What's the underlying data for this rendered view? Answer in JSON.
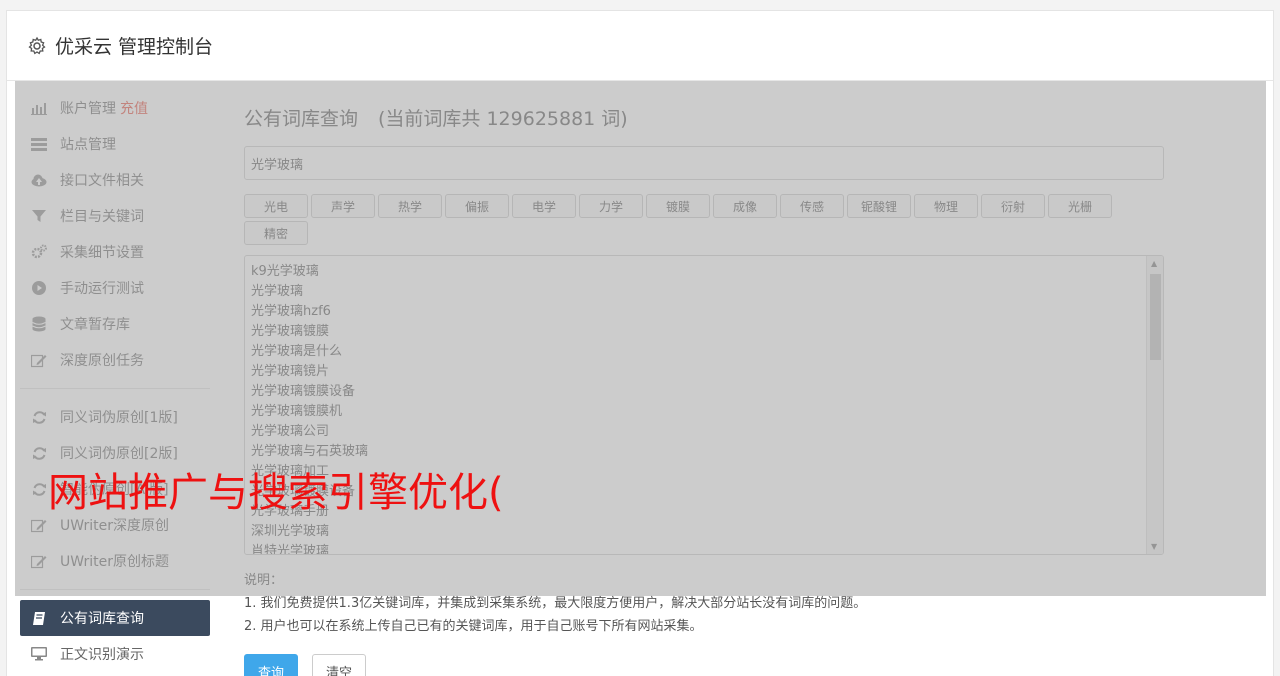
{
  "header": {
    "title": "优采云 管理控制台",
    "icon": "gear-icon"
  },
  "sidebar": {
    "items": [
      {
        "label": "账户管理",
        "badge": "充值",
        "icon": "bar-chart-icon"
      },
      {
        "label": "站点管理",
        "icon": "server-icon"
      },
      {
        "label": "接口文件相关",
        "icon": "cloud-upload-icon"
      },
      {
        "label": "栏目与关键词",
        "icon": "filter-icon"
      },
      {
        "label": "采集细节设置",
        "icon": "gears-icon"
      },
      {
        "label": "手动运行测试",
        "icon": "play-circle-icon"
      },
      {
        "label": "文章暂存库",
        "icon": "database-icon"
      },
      {
        "label": "深度原创任务",
        "icon": "edit-icon"
      }
    ],
    "items2": [
      {
        "label": "同义词伪原创[1版]",
        "icon": "refresh-icon"
      },
      {
        "label": "同义词伪原创[2版]",
        "icon": "refresh-icon"
      },
      {
        "label": "智能伪原创[AI版]",
        "icon": "refresh-icon"
      },
      {
        "label": "UWriter深度原创",
        "icon": "edit-icon"
      },
      {
        "label": "UWriter原创标题",
        "icon": "edit-icon"
      }
    ],
    "items3": [
      {
        "label": "公有词库查询",
        "icon": "book-icon",
        "active": true
      },
      {
        "label": "正文识别演示",
        "icon": "monitor-icon"
      }
    ]
  },
  "main": {
    "title": "公有词库查询",
    "count_text": "(当前词库共 129625881 词)",
    "search_value": "光学玻璃",
    "tags": [
      "光电",
      "声学",
      "热学",
      "偏振",
      "电学",
      "力学",
      "镀膜",
      "成像",
      "传感",
      "铌酸锂",
      "物理",
      "衍射",
      "光栅",
      "精密"
    ],
    "results": [
      "k9光学玻璃",
      "光学玻璃",
      "光学玻璃hzf6",
      "光学玻璃镀膜",
      "光学玻璃是什么",
      "光学玻璃镜片",
      "光学玻璃镀膜设备",
      "光学玻璃镀膜机",
      "光学玻璃公司",
      "光学玻璃与石英玻璃",
      "光学玻璃加工",
      "光学玻璃镀膜设备",
      "光学玻璃手册",
      "深圳光学玻璃",
      "肖特光学玻璃"
    ],
    "notes_title": "说明：",
    "notes": [
      "1. 我们免费提供1.3亿关键词库，并集成到采集系统，最大限度方便用户，解决大部分站长没有词库的问题。",
      "2. 用户也可以在系统上传自己已有的关键词库，用于自己账号下所有网站采集。"
    ],
    "query_button": "查询",
    "clear_button": "清空"
  },
  "watermark": "网站推广与搜索引擎优化(",
  "colors": {
    "accent": "#3fa7ea",
    "active_nav": "#3b4a5e",
    "badge": "#e74c3c",
    "watermark": "#ee1111"
  }
}
